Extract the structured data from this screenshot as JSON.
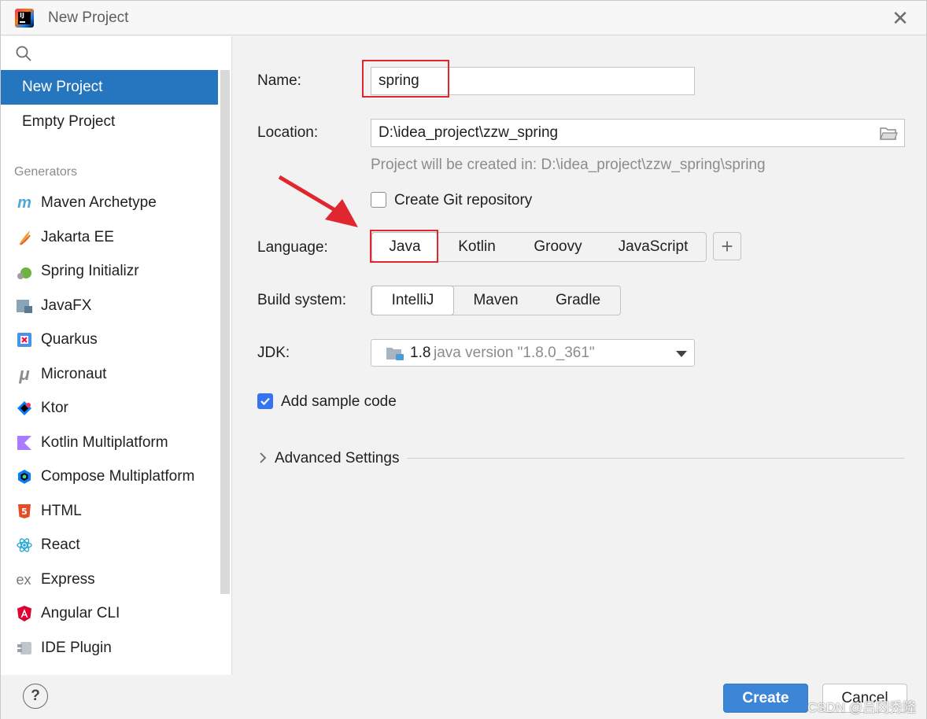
{
  "window": {
    "title": "New Project"
  },
  "sidebar": {
    "top_items": [
      {
        "label": "New Project",
        "selected": true
      },
      {
        "label": "Empty Project",
        "selected": false
      }
    ],
    "generators_label": "Generators",
    "generators": [
      {
        "label": "Maven Archetype",
        "icon": "maven-icon"
      },
      {
        "label": "Jakarta EE",
        "icon": "jakarta-ee-icon"
      },
      {
        "label": "Spring Initializr",
        "icon": "spring-icon"
      },
      {
        "label": "JavaFX",
        "icon": "javafx-icon"
      },
      {
        "label": "Quarkus",
        "icon": "quarkus-icon"
      },
      {
        "label": "Micronaut",
        "icon": "micronaut-icon"
      },
      {
        "label": "Ktor",
        "icon": "ktor-icon"
      },
      {
        "label": "Kotlin Multiplatform",
        "icon": "kotlin-icon"
      },
      {
        "label": "Compose Multiplatform",
        "icon": "compose-icon"
      },
      {
        "label": "HTML",
        "icon": "html5-icon"
      },
      {
        "label": "React",
        "icon": "react-icon"
      },
      {
        "label": "Express",
        "icon": "express-icon"
      },
      {
        "label": "Angular CLI",
        "icon": "angular-icon"
      },
      {
        "label": "IDE Plugin",
        "icon": "plugin-icon"
      }
    ]
  },
  "form": {
    "name_label": "Name:",
    "name_value": "spring",
    "location_label": "Location:",
    "location_value": "D:\\idea_project\\zzw_spring",
    "location_hint": "Project will be created in: D:\\idea_project\\zzw_spring\\spring",
    "git_label": "Create Git repository",
    "git_checked": false,
    "language_label": "Language:",
    "languages": [
      "Java",
      "Kotlin",
      "Groovy",
      "JavaScript"
    ],
    "language_selected": "Java",
    "build_label": "Build system:",
    "build_systems": [
      "IntelliJ",
      "Maven",
      "Gradle"
    ],
    "build_selected": "IntelliJ",
    "jdk_label": "JDK:",
    "jdk_version": "1.8",
    "jdk_description": "java version \"1.8.0_361\"",
    "sample_code_label": "Add sample code",
    "sample_code_checked": true,
    "advanced_label": "Advanced Settings"
  },
  "footer": {
    "help_label": "?",
    "create_label": "Create",
    "cancel_label": "Cancel"
  },
  "watermark": "CSDN @吕冈秀隆",
  "colors": {
    "selection": "#2675bf",
    "primary_button": "#3d85d6",
    "annotation_red": "#e0262f",
    "checkbox_checked": "#3574f0"
  }
}
